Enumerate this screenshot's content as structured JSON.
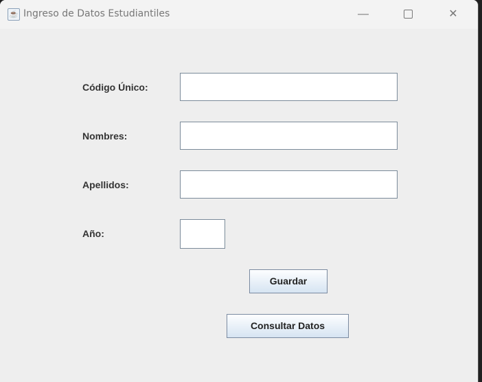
{
  "window": {
    "title": "Ingreso de Datos Estudiantiles",
    "minimize": "—",
    "close": "✕"
  },
  "form": {
    "codigo_label": "Código Único:",
    "codigo_value": "",
    "nombres_label": "Nombres:",
    "nombres_value": "",
    "apellidos_label": "Apellidos:",
    "apellidos_value": "",
    "anio_label": "Año:",
    "anio_value": ""
  },
  "buttons": {
    "guardar": "Guardar",
    "consultar": "Consultar Datos"
  }
}
